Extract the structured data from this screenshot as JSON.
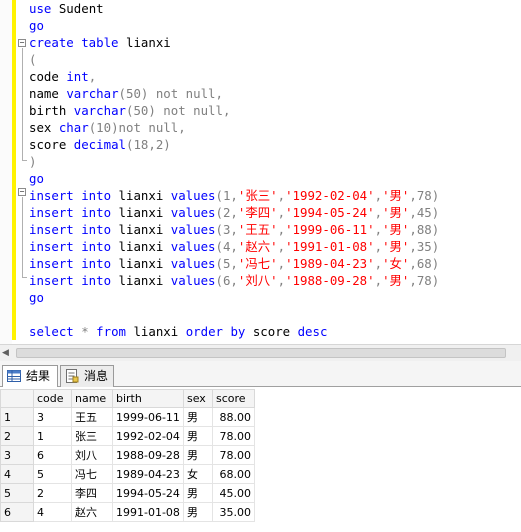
{
  "editor": {
    "lines": [
      [
        [
          "kw",
          "use"
        ],
        [
          "bk",
          " Sudent"
        ]
      ],
      [
        [
          "kw",
          "go"
        ]
      ],
      [
        [
          "kw",
          "create table"
        ],
        [
          "bk",
          " lianxi"
        ]
      ],
      [
        [
          "gr",
          "("
        ]
      ],
      [
        [
          "bk",
          "code "
        ],
        [
          "kw",
          "int"
        ],
        [
          "gr",
          ","
        ]
      ],
      [
        [
          "bk",
          "name "
        ],
        [
          "kw",
          "varchar"
        ],
        [
          "gr",
          "(50) not null,"
        ]
      ],
      [
        [
          "bk",
          "birth "
        ],
        [
          "kw",
          "varchar"
        ],
        [
          "gr",
          "(50) not null,"
        ]
      ],
      [
        [
          "bk",
          "sex "
        ],
        [
          "kw",
          "char"
        ],
        [
          "gr",
          "(10)not null,"
        ]
      ],
      [
        [
          "bk",
          "score "
        ],
        [
          "kw",
          "decimal"
        ],
        [
          "gr",
          "(18,2)"
        ]
      ],
      [
        [
          "gr",
          ")"
        ]
      ],
      [
        [
          "kw",
          "go"
        ]
      ],
      [
        [
          "kw",
          "insert into"
        ],
        [
          "bk",
          " lianxi "
        ],
        [
          "kw",
          "values"
        ],
        [
          "gr",
          "(1,"
        ],
        [
          "st",
          "'张三'"
        ],
        [
          "gr",
          ","
        ],
        [
          "st",
          "'1992-02-04'"
        ],
        [
          "gr",
          ","
        ],
        [
          "st",
          "'男'"
        ],
        [
          "gr",
          ",78)"
        ]
      ],
      [
        [
          "kw",
          "insert into"
        ],
        [
          "bk",
          " lianxi "
        ],
        [
          "kw",
          "values"
        ],
        [
          "gr",
          "(2,"
        ],
        [
          "st",
          "'李四'"
        ],
        [
          "gr",
          ","
        ],
        [
          "st",
          "'1994-05-24'"
        ],
        [
          "gr",
          ","
        ],
        [
          "st",
          "'男'"
        ],
        [
          "gr",
          ",45)"
        ]
      ],
      [
        [
          "kw",
          "insert into"
        ],
        [
          "bk",
          " lianxi "
        ],
        [
          "kw",
          "values"
        ],
        [
          "gr",
          "(3,"
        ],
        [
          "st",
          "'王五'"
        ],
        [
          "gr",
          ","
        ],
        [
          "st",
          "'1999-06-11'"
        ],
        [
          "gr",
          ","
        ],
        [
          "st",
          "'男'"
        ],
        [
          "gr",
          ",88)"
        ]
      ],
      [
        [
          "kw",
          "insert into"
        ],
        [
          "bk",
          " lianxi "
        ],
        [
          "kw",
          "values"
        ],
        [
          "gr",
          "(4,"
        ],
        [
          "st",
          "'赵六'"
        ],
        [
          "gr",
          ","
        ],
        [
          "st",
          "'1991-01-08'"
        ],
        [
          "gr",
          ","
        ],
        [
          "st",
          "'男'"
        ],
        [
          "gr",
          ",35)"
        ]
      ],
      [
        [
          "kw",
          "insert into"
        ],
        [
          "bk",
          " lianxi "
        ],
        [
          "kw",
          "values"
        ],
        [
          "gr",
          "(5,"
        ],
        [
          "st",
          "'冯七'"
        ],
        [
          "gr",
          ","
        ],
        [
          "st",
          "'1989-04-23'"
        ],
        [
          "gr",
          ","
        ],
        [
          "st",
          "'女'"
        ],
        [
          "gr",
          ",68)"
        ]
      ],
      [
        [
          "kw",
          "insert into"
        ],
        [
          "bk",
          " lianxi "
        ],
        [
          "kw",
          "values"
        ],
        [
          "gr",
          "(6,"
        ],
        [
          "st",
          "'刘八'"
        ],
        [
          "gr",
          ","
        ],
        [
          "st",
          "'1988-09-28'"
        ],
        [
          "gr",
          ","
        ],
        [
          "st",
          "'男'"
        ],
        [
          "gr",
          ",78)"
        ]
      ],
      [
        [
          "kw",
          "go"
        ]
      ],
      [],
      [
        [
          "kw",
          "select"
        ],
        [
          "gr",
          " * "
        ],
        [
          "kw",
          "from"
        ],
        [
          "bk",
          " lianxi "
        ],
        [
          "kw",
          "order by"
        ],
        [
          "bk",
          " score "
        ],
        [
          "kw",
          "desc"
        ]
      ]
    ]
  },
  "tabs": [
    {
      "label": "结果",
      "icon": "grid-icon",
      "active": true
    },
    {
      "label": "消息",
      "icon": "messages-icon",
      "active": false
    }
  ],
  "results": {
    "columns": [
      "code",
      "name",
      "birth",
      "sex",
      "score"
    ],
    "rows": [
      {
        "rownum": "1",
        "code": "3",
        "name": "王五",
        "birth": "1999-06-11",
        "sex": "男",
        "score": "88.00"
      },
      {
        "rownum": "2",
        "code": "1",
        "name": "张三",
        "birth": "1992-02-04",
        "sex": "男",
        "score": "78.00"
      },
      {
        "rownum": "3",
        "code": "6",
        "name": "刘八",
        "birth": "1988-09-28",
        "sex": "男",
        "score": "78.00"
      },
      {
        "rownum": "4",
        "code": "5",
        "name": "冯七",
        "birth": "1989-04-23",
        "sex": "女",
        "score": "68.00"
      },
      {
        "rownum": "5",
        "code": "2",
        "name": "李四",
        "birth": "1994-05-24",
        "sex": "男",
        "score": "45.00"
      },
      {
        "rownum": "6",
        "code": "4",
        "name": "赵六",
        "birth": "1991-01-08",
        "sex": "男",
        "score": "35.00"
      }
    ]
  },
  "colors": {
    "keyword": "#0000ff",
    "operator": "#808080",
    "string": "#ff0000",
    "change_bar": "#fff200"
  }
}
